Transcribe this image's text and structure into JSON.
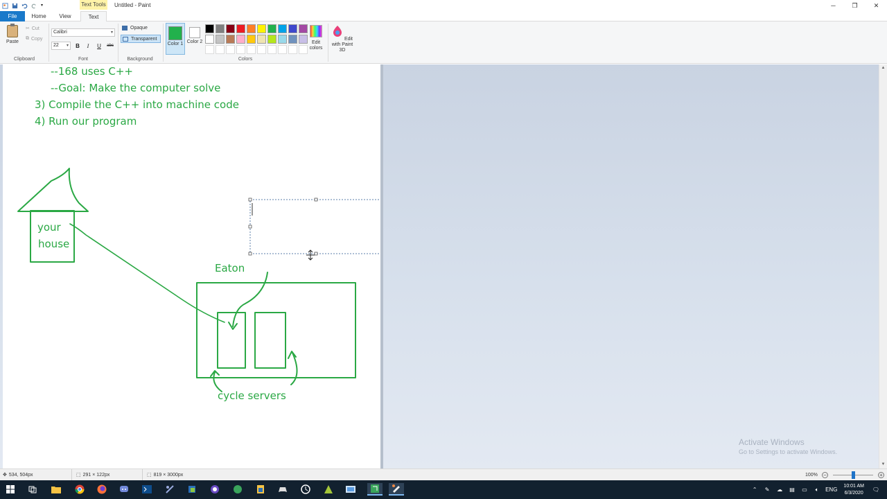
{
  "titlebar": {
    "context_tab": "Text Tools",
    "title": "Untitled - Paint",
    "controls": [
      "minimize",
      "restore",
      "close"
    ]
  },
  "tabs": [
    {
      "label": "File"
    },
    {
      "label": "Home"
    },
    {
      "label": "View"
    },
    {
      "label": "Text"
    }
  ],
  "ribbon": {
    "clipboard": {
      "paste": "Paste",
      "cut": "Cut",
      "copy": "Copy",
      "group": "Clipboard"
    },
    "font": {
      "family": "Calibri",
      "size": "22",
      "bold": "B",
      "italic": "I",
      "underline": "U",
      "strike": "abc",
      "group": "Font"
    },
    "background": {
      "opaque": "Opaque",
      "transparent": "Transparent",
      "group": "Background"
    },
    "colors": {
      "color1_label": "Color 1",
      "color2_label": "Color 2",
      "color1": "#22b14c",
      "color2": "#ffffff",
      "palette_row1": [
        "#000000",
        "#7f7f7f",
        "#880015",
        "#ed1c24",
        "#ff7f27",
        "#fff200",
        "#22b14c",
        "#00a2e8",
        "#3f48cc",
        "#a349a4"
      ],
      "palette_row2": [
        "#ffffff",
        "#c3c3c3",
        "#b97a57",
        "#ffaec9",
        "#ffc90e",
        "#efe4b0",
        "#b5e61d",
        "#99d9ea",
        "#7092be",
        "#c8bfe7"
      ],
      "edit_colors": "Edit colors",
      "group": "Colors"
    },
    "paint3d": "Edit with Paint 3D"
  },
  "canvas": {
    "ink_color": "#2aa844",
    "lines": [
      "--168 uses C++",
      "--Goal: Make the computer solve",
      "3) Compile the C++ into machine code",
      "4) Run our program"
    ],
    "labels": {
      "house_1": "your",
      "house_2": "house",
      "eaton": "Eaton",
      "servers": "cycle servers"
    }
  },
  "watermark": {
    "line1": "Activate Windows",
    "line2": "Go to Settings to activate Windows."
  },
  "status": {
    "cursor": "534, 504px",
    "selection": "291 × 122px",
    "image_size": "819 × 3000px",
    "zoom": "100%"
  },
  "taskbar": {
    "apps": [
      "start",
      "search",
      "task-view",
      "file-explorer",
      "chrome",
      "firefox",
      "discord",
      "zoom",
      "powershell",
      "app",
      "app",
      "app",
      "app",
      "games",
      "app",
      "app",
      "notepad",
      "app",
      "paint"
    ],
    "language": "ENG",
    "time": "10:01 AM",
    "date": "6/3/2020"
  }
}
